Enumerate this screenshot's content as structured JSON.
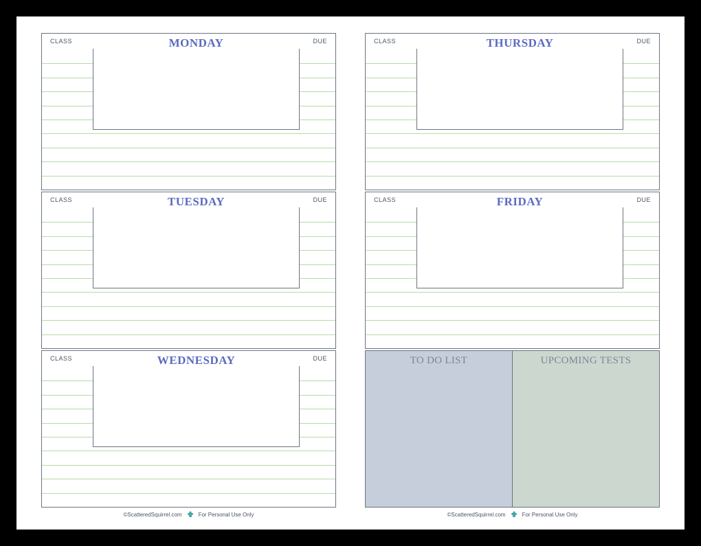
{
  "labels": {
    "class": "CLASS",
    "due": "DUE"
  },
  "leftPage": {
    "days": [
      "MONDAY",
      "TUESDAY",
      "WEDNESDAY"
    ]
  },
  "rightPage": {
    "days": [
      "THURSDAY",
      "FRIDAY"
    ],
    "todo": "TO DO LIST",
    "tests": "UPCOMING TESTS"
  },
  "footer": {
    "copyright": "©ScatteredSquirrel.com",
    "note": "For Personal Use Only"
  },
  "colors": {
    "dayTitle": "#5c6bc0",
    "rule": "#b6dba8",
    "border": "#6b7280",
    "todoBg": "#c6cddb",
    "testsBg": "#ccd7d0",
    "squirrel": "#4aa8a4"
  }
}
